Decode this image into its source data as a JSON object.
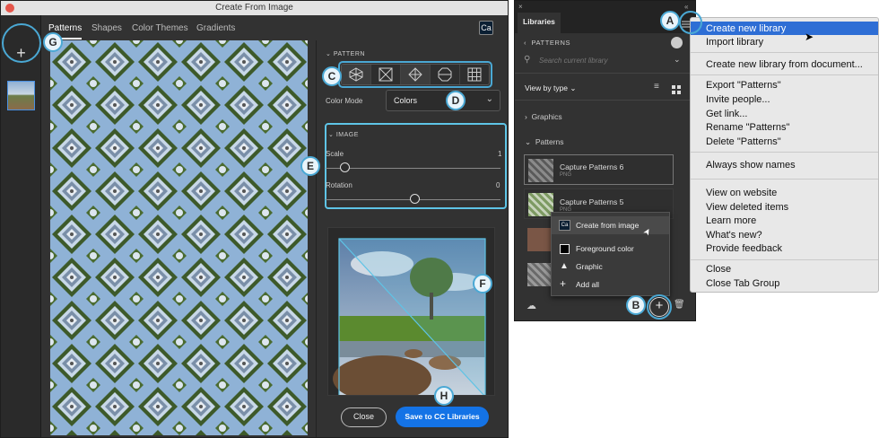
{
  "dialog": {
    "title": "Create From Image",
    "tabs": [
      "Patterns",
      "Shapes",
      "Color Themes",
      "Gradients"
    ],
    "ca_badge": "Ca",
    "add_button": "+",
    "pattern_section": "PATTERN",
    "color_mode_label": "Color Mode",
    "color_mode_value": "Colors",
    "image_section": "IMAGE",
    "scale_label": "Scale",
    "scale_value": "1",
    "rotation_label": "Rotation",
    "rotation_value": "0",
    "close_button": "Close",
    "save_button": "Save to CC Libraries"
  },
  "libraries": {
    "tab": "Libraries",
    "breadcrumb": "PATTERNS",
    "search_placeholder": "Search current library",
    "view_by": "View by type",
    "group_graphics": "Graphics",
    "group_patterns": "Patterns",
    "items": [
      {
        "name": "Capture Patterns 6",
        "type": "PNG"
      },
      {
        "name": "Capture Patterns 5",
        "type": "PNG"
      }
    ],
    "context_menu": [
      "Create from image",
      "Foreground color",
      "Graphic",
      "Add all"
    ]
  },
  "flyout_menu": {
    "items": [
      "Create new library",
      "Import library",
      "Create new library from document...",
      "Export \"Patterns\"",
      "Invite people...",
      "Get link...",
      "Rename \"Patterns\"",
      "Delete \"Patterns\"",
      "Always show names",
      "View on website",
      "View deleted items",
      "Learn more",
      "What's new?",
      "Provide feedback",
      "Close",
      "Close Tab Group"
    ],
    "selected": "Create new library"
  },
  "callouts": [
    "A",
    "B",
    "C",
    "D",
    "E",
    "F",
    "G",
    "H"
  ],
  "colors": {
    "accent": "#1473e6",
    "callout_ring": "#4aa8d4",
    "panel_bg": "#323232"
  }
}
